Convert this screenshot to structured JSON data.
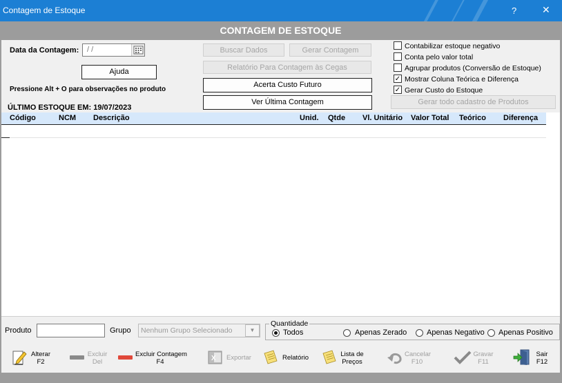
{
  "window": {
    "title": "Contagem de Estoque",
    "help_glyph": "?",
    "close_glyph": "✕"
  },
  "header": {
    "title": "CONTAGEM DE ESTOQUE"
  },
  "form": {
    "date_label": "Data da Contagem:",
    "date_value": "/ /",
    "help_button": "Ajuda",
    "hint": "Pressione Alt + O para observações no produto",
    "last_stock": "ÚLTIMO ESTOQUE EM: 19/07/2023"
  },
  "actions": {
    "buscar": "Buscar Dados",
    "gerar_contagem": "Gerar Contagem",
    "relatorio_cegas": "Relatório Para Contagem às Cegas",
    "acerta_custo": "Acerta Custo Futuro",
    "ver_ultima": "Ver Última Contagem",
    "gerar_todo": "Gerar todo cadastro de Produtos"
  },
  "options": [
    {
      "label": "Contabilizar estoque negativo",
      "checked": false
    },
    {
      "label": "Conta pelo valor total",
      "checked": false
    },
    {
      "label": "Agrupar produtos (Conversão de Estoque)",
      "checked": false
    },
    {
      "label": "Mostrar Coluna Teórica e Diferença",
      "checked": true
    },
    {
      "label": "Gerar Custo do Estoque",
      "checked": true
    }
  ],
  "grid": {
    "columns": [
      "Código",
      "NCM",
      "Descrição",
      "Unid.",
      "Qtde",
      "Vl. Unitário",
      "Valor Total",
      "Teórico",
      "Diferença"
    ]
  },
  "filter": {
    "produto_label": "Produto",
    "produto_value": "",
    "grupo_label": "Grupo",
    "grupo_value": "Nenhum Grupo Selecionado",
    "quantidade_legend": "Quantidade",
    "radios": [
      {
        "label": "Todos",
        "selected": true
      },
      {
        "label": "Apenas Zerado",
        "selected": false
      },
      {
        "label": "Apenas Negativo",
        "selected": false
      },
      {
        "label": "Apenas Positivo",
        "selected": false
      }
    ]
  },
  "toolbar": {
    "alterar": [
      "Alterar",
      "F2"
    ],
    "excluir": [
      "Excluir",
      "Del"
    ],
    "excluir_contagem": [
      "Excluir Contagem",
      "F4"
    ],
    "exportar": "Exportar",
    "relatorio": "Relatório",
    "lista_precos": [
      "Lista de",
      "Preços"
    ],
    "cancelar": [
      "Cancelar",
      "F10"
    ],
    "gravar": [
      "Gravar",
      "F11"
    ],
    "sair": [
      "Sair",
      "F12"
    ]
  },
  "colors": {
    "titlebar": "#1c7fd4",
    "header_band": "#9c9c9c",
    "grid_header": "#d6e8fb",
    "excluir_contagem_icon": "#e0483a"
  },
  "icons": [
    "pencil-icon",
    "minus-icon",
    "excel-icon",
    "notepad-icon",
    "undo-icon",
    "checkmark-icon",
    "exit-door-icon",
    "calendar-icon",
    "dropdown-arrow-icon"
  ]
}
